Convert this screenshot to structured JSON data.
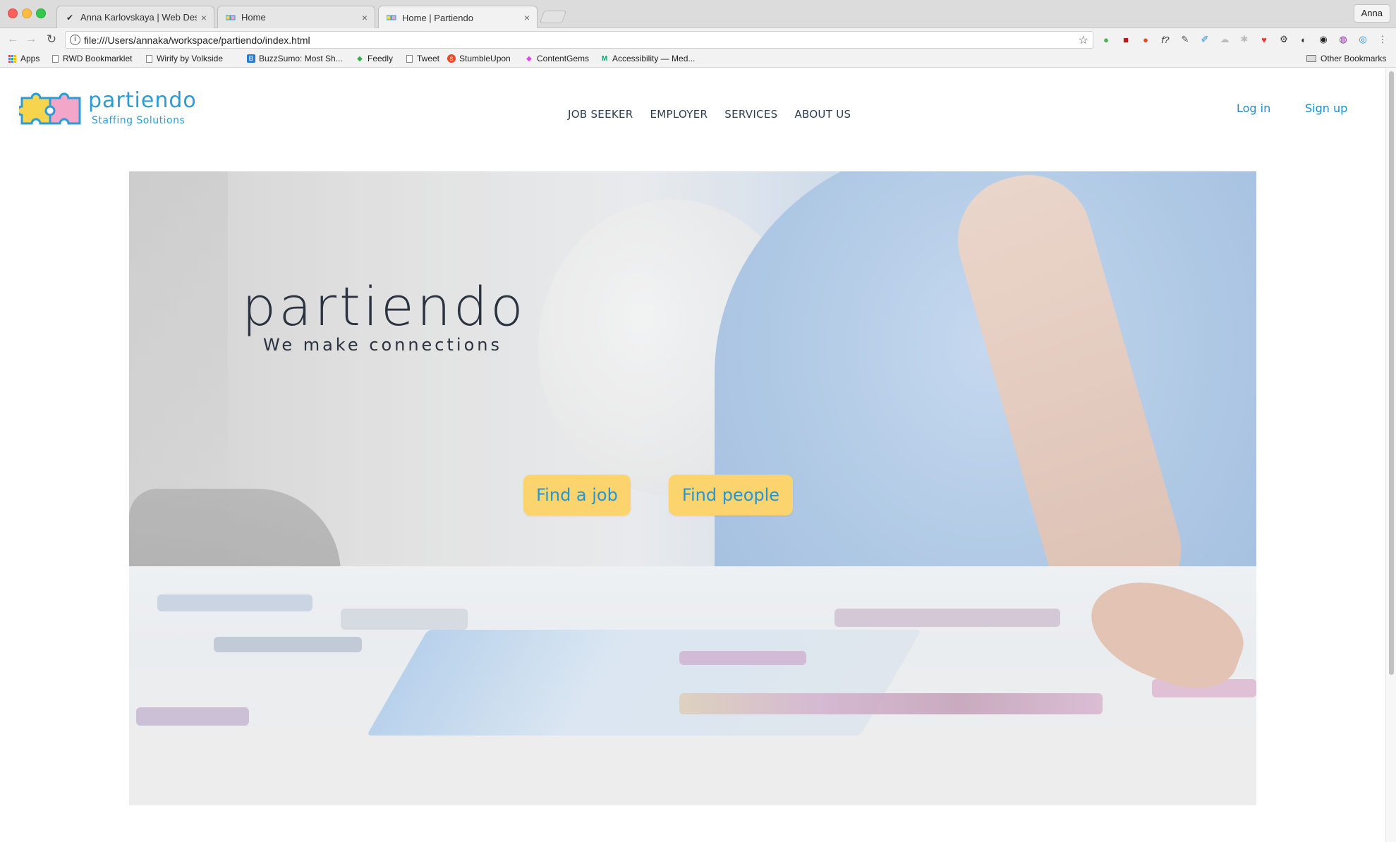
{
  "browser": {
    "tabs": [
      {
        "label": "Anna Karlovskaya | Web Desig",
        "favicon": "bird-icon"
      },
      {
        "label": "Home",
        "favicon": "partiendo-icon"
      },
      {
        "label": "Home | Partiendo",
        "favicon": "partiendo-icon"
      }
    ],
    "profile_name": "Anna",
    "url": "file:///Users/annaka/workspace/partiendo/index.html",
    "bookmarks": [
      {
        "label": "Apps",
        "icon": "apps-grid-icon"
      },
      {
        "label": "RWD Bookmarklet",
        "icon": "page-icon"
      },
      {
        "label": "Wirify by Volkside",
        "icon": "page-icon"
      },
      {
        "label": "BuzzSumo: Most Sh...",
        "icon": "buzzsumo-icon"
      },
      {
        "label": "Feedly",
        "icon": "feedly-icon"
      },
      {
        "label": "Tweet",
        "icon": "page-icon"
      },
      {
        "label": "StumbleUpon",
        "icon": "stumbleupon-icon"
      },
      {
        "label": "ContentGems",
        "icon": "contentgems-icon"
      },
      {
        "label": "Accessibility — Med...",
        "icon": "medium-icon"
      }
    ],
    "other_bookmarks": "Other Bookmarks"
  },
  "site": {
    "logo": {
      "name": "partiendo",
      "tagline": "Staffing Solutions"
    },
    "nav": [
      "JOB SEEKER",
      "EMPLOYER",
      "SERVICES",
      "ABOUT US"
    ],
    "login": "Log in",
    "signup": "Sign up",
    "hero": {
      "title": "partiendo",
      "subtitle": "We make connections",
      "cta_job": "Find a job",
      "cta_people": "Find people"
    }
  },
  "colors": {
    "brand_blue": "#2d9bd6",
    "cta_yellow": "#fbd46e",
    "nav_text": "#2c3e50"
  }
}
